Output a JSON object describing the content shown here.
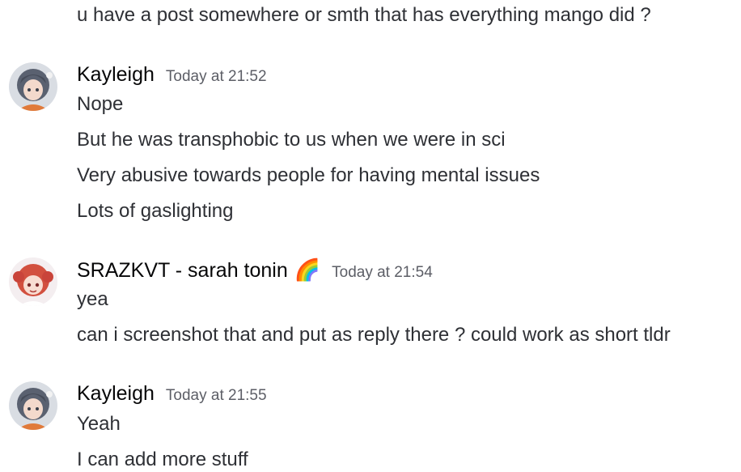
{
  "messages": [
    {
      "continuation": true,
      "lines": [
        "u have a post somewhere or smth that has everything mango did ?"
      ]
    },
    {
      "username": "Kayleigh",
      "timestamp": "Today at 21:52",
      "avatar_icon": "anime-girl-avatar",
      "lines": [
        "Nope",
        "But he was transphobic to us when we were in sci",
        "Very abusive towards people for having mental issues",
        "Lots of gaslighting"
      ]
    },
    {
      "username": "SRAZKVT - sarah tonin",
      "name_emoji": "🌈",
      "timestamp": "Today at 21:54",
      "avatar_icon": "anime-redhead-avatar",
      "lines": [
        "yea",
        "can i screenshot that and put as reply there ? could work as short tldr"
      ]
    },
    {
      "username": "Kayleigh",
      "timestamp": "Today at 21:55",
      "avatar_icon": "anime-girl-avatar",
      "lines": [
        "Yeah",
        "I can add more stuff"
      ]
    }
  ]
}
